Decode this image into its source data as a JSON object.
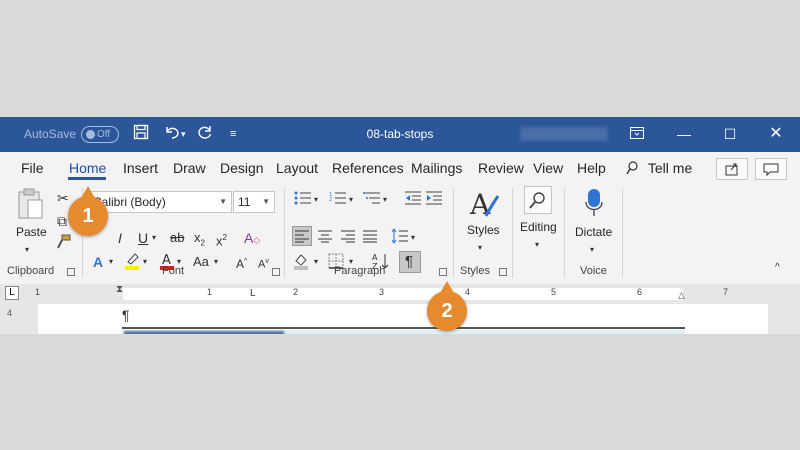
{
  "titlebar": {
    "autosave_label": "AutoSave",
    "autosave_state": "Off",
    "doc_title": "08-tab-stops"
  },
  "tabs": [
    "File",
    "Home",
    "Insert",
    "Draw",
    "Design",
    "Layout",
    "References",
    "Mailings",
    "Review",
    "View",
    "Help"
  ],
  "tellme": "Tell me",
  "ribbon": {
    "paste_label": "Paste",
    "clipboard_label": "Clipboard",
    "font_name": "Calibri (Body)",
    "font_size": "11",
    "font_label": "Font",
    "paragraph_label": "Paragraph",
    "styles_btn": "Styles",
    "styles_label": "Styles",
    "editing_btn": "Editing",
    "dictate_btn": "Dictate",
    "voice_label": "Voice"
  },
  "ruler_numbers": [
    "1",
    "1",
    "2",
    "3",
    "4",
    "5",
    "6",
    "7"
  ],
  "document": {
    "pilcrow": "¶"
  },
  "badges": [
    "1",
    "2"
  ],
  "colors": {
    "titlebar": "#2b579a",
    "badge": "#e58a2e",
    "ribbon_bg": "#f3f3f3"
  }
}
